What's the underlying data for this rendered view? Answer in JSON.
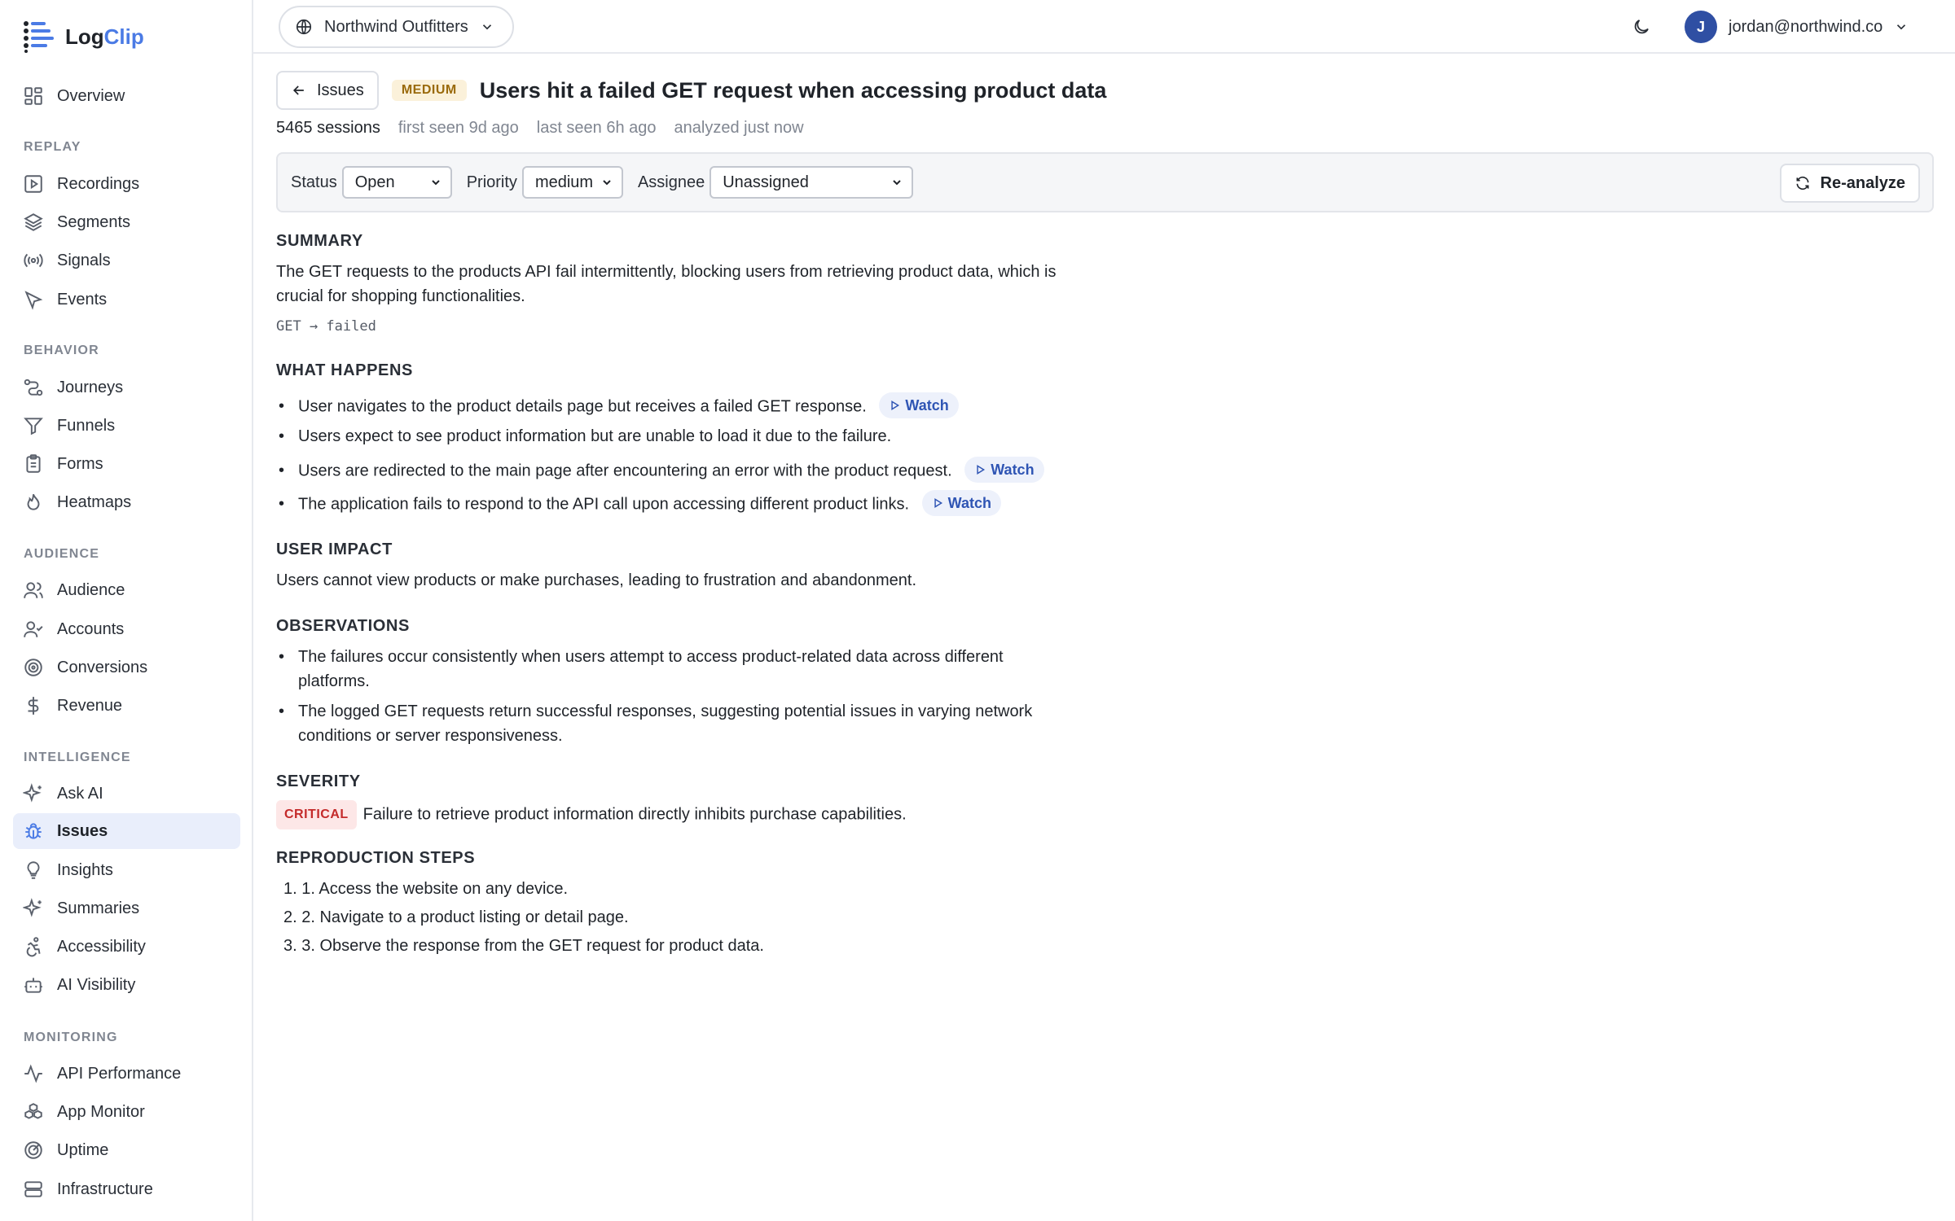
{
  "app": {
    "logo_main": "Log",
    "logo_accent": "Clip"
  },
  "sidebar": {
    "overview": "Overview",
    "sections": {
      "replay": "REPLAY",
      "behavior": "BEHAVIOR",
      "audience": "AUDIENCE",
      "intelligence": "INTELLIGENCE",
      "monitoring": "MONITORING"
    },
    "items": {
      "recordings": "Recordings",
      "segments": "Segments",
      "signals": "Signals",
      "events": "Events",
      "journeys": "Journeys",
      "funnels": "Funnels",
      "forms": "Forms",
      "heatmaps": "Heatmaps",
      "audience": "Audience",
      "accounts": "Accounts",
      "conversions": "Conversions",
      "revenue": "Revenue",
      "ask_ai": "Ask AI",
      "issues": "Issues",
      "insights": "Insights",
      "summaries": "Summaries",
      "accessibility": "Accessibility",
      "ai_visibility": "AI Visibility",
      "api_performance": "API Performance",
      "app_monitor": "App Monitor",
      "uptime": "Uptime",
      "infrastructure": "Infrastructure"
    },
    "active": "issues"
  },
  "topbar": {
    "workspace": "Northwind Outfitters",
    "user_initial": "J",
    "user_email": "jordan@northwind.co"
  },
  "issue": {
    "back_label": "Issues",
    "priority_badge": "MEDIUM",
    "title": "Users hit a failed GET request when accessing product data",
    "sessions_count": "5465",
    "sessions_label": "sessions",
    "first_seen": "first seen 9d ago",
    "last_seen": "last seen 6h ago",
    "analyzed": "analyzed just now"
  },
  "filters": {
    "status_label": "Status",
    "status_value": "Open",
    "priority_label": "Priority",
    "priority_value": "medium",
    "assignee_label": "Assignee",
    "assignee_value": "Unassigned",
    "reanalyze_label": "Re-analyze"
  },
  "summary": {
    "heading": "SUMMARY",
    "text": "The GET requests to the products API fail intermittently, blocking users from retrieving product data, which is crucial for shopping functionalities.",
    "code": "GET → failed"
  },
  "what_happens": {
    "heading": "WHAT HAPPENS",
    "watch_label": "Watch",
    "items": [
      "User navigates to the product details page but receives a failed GET response.",
      "Users expect to see product information but are unable to load it due to the failure.",
      "Users are redirected to the main page after encountering an error with the product request.",
      "The application fails to respond to the API call upon accessing different product links."
    ]
  },
  "user_impact": {
    "heading": "USER IMPACT",
    "text": "Users cannot view products or make purchases, leading to frustration and abandonment."
  },
  "observations": {
    "heading": "OBSERVATIONS",
    "items": [
      "The failures occur consistently when users attempt to access product-related data across different platforms.",
      "The logged GET requests return successful responses, suggesting potential issues in varying network conditions or server responsiveness."
    ]
  },
  "severity": {
    "heading": "SEVERITY",
    "badge": "CRITICAL",
    "text": "Failure to retrieve product information directly inhibits purchase capabilities."
  },
  "reproduction": {
    "heading": "REPRODUCTION STEPS",
    "steps": [
      "1. 1. Access the website on any device.",
      "2. 2. Navigate to a product listing or detail page.",
      "3. 3. Observe the response from the GET request for product data."
    ]
  },
  "colors": {
    "accent": "#4b7be5",
    "active_bg": "#e9eefb",
    "medium_bg": "#fbf1da",
    "medium_fg": "#9a6a0c",
    "critical_bg": "#fde7e7",
    "critical_fg": "#c42b2b",
    "avatar": "#2f4fa3"
  }
}
